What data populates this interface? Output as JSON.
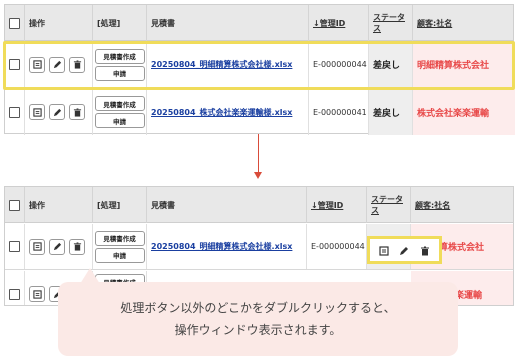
{
  "top_table": {
    "headers": {
      "ops": "操作",
      "process": "[処理]",
      "estimate": "見積書",
      "mgmt_id": "↓管理ID",
      "status": "ステータス",
      "customer": "顧客:社名"
    },
    "rows": [
      {
        "btn_create": "見積書作成",
        "btn_apply": "申請",
        "filename": "20250804_明細精算株式会社様.xlsx",
        "mgmt_id": "E-000000044",
        "status": "差戻し",
        "customer": "明細精算株式会社"
      },
      {
        "btn_create": "見積書作成",
        "btn_apply": "申請",
        "filename": "20250804_株式会社楽楽運輸様.xlsx",
        "mgmt_id": "E-000000041",
        "status": "差戻し",
        "customer": "株式会社楽楽運輸"
      }
    ]
  },
  "bottom_table": {
    "headers": {
      "ops": "操作",
      "process": "[処理]",
      "estimate": "見積書",
      "mgmt_id": "↓管理ID",
      "status": "ステータス",
      "customer": "顧客:社名"
    },
    "rows": [
      {
        "btn_create": "見積書作成",
        "btn_apply": "申請",
        "filename": "20250804_明細精算株式会社様.xlsx",
        "mgmt_id": "E-000000044",
        "customer": "算株式会社"
      },
      {
        "btn_create": "見積書作成",
        "customer": "楽運輸"
      }
    ]
  },
  "callout": {
    "line1": "処理ボタン以外のどこかをダブルクリックすると、",
    "line2": "操作ウィンドウ表示されます。"
  },
  "colors": {
    "highlight": "#f0dc5a",
    "customer": "#e84a4a",
    "link": "#1a3fa0",
    "arrow": "#d94c3a"
  },
  "icons": [
    "document-icon",
    "pencil-icon",
    "trash-icon"
  ]
}
